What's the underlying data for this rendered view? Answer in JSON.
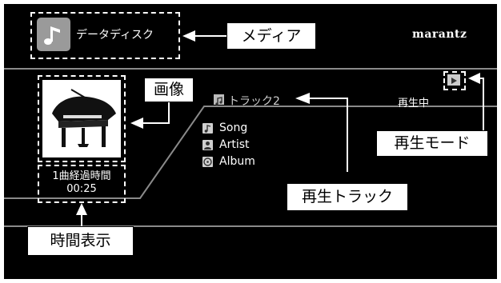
{
  "header": {
    "media_type_label": "データディスク",
    "brand": "marantz"
  },
  "status": {
    "playback_status": "再生中",
    "current_track": "トラック2"
  },
  "track_info": {
    "song": "Song",
    "artist": "Artist",
    "album": "Album"
  },
  "time": {
    "label": "1曲経過時間",
    "elapsed": "00:25"
  },
  "callouts": {
    "media": "メディア",
    "image": "画像",
    "play_mode": "再生モード",
    "play_track": "再生トラック",
    "time_display": "時間表示"
  },
  "icons": {
    "media_icon": "music-note-icon",
    "play_mode_icon": "play-icon",
    "track_icon": "music-file-icon",
    "song_icon": "music-note-icon",
    "artist_icon": "person-icon",
    "album_icon": "disc-icon"
  },
  "colors": {
    "screen_bg": "#000000",
    "separator": "#8a8a8a",
    "text": "#ffffff",
    "media_icon_bg": "#9a9a9a"
  }
}
